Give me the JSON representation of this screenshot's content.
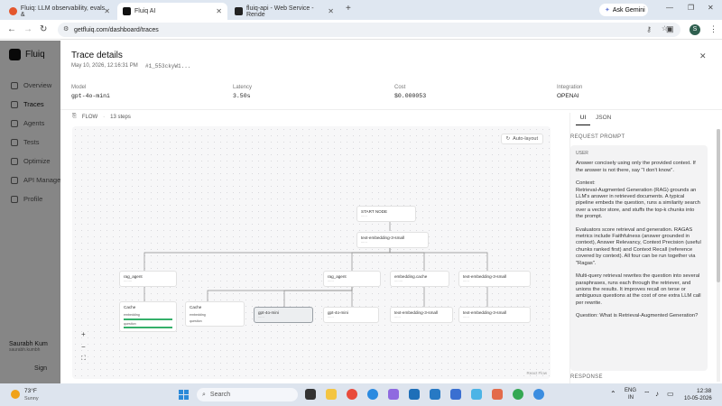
{
  "browser": {
    "tabs": [
      {
        "title": "Fluiq: LLM observability, evals &",
        "favicon_color": "#e4572e"
      },
      {
        "title": "Fluiq AI",
        "favicon_color": "#111111"
      },
      {
        "title": "fluiq-api - Web Service - Rende",
        "favicon_color": "#222222"
      }
    ],
    "new_tab": "+",
    "gemini_label": "Ask Gemini",
    "url": "getfluiq.com/dashboard/traces",
    "profile_initial": "S"
  },
  "sidebar": {
    "logo": "Fluiq",
    "items": [
      {
        "label": "Overview"
      },
      {
        "label": "Traces"
      },
      {
        "label": "Agents"
      },
      {
        "label": "Tests"
      },
      {
        "label": "Optimize"
      },
      {
        "label": "API Manager"
      },
      {
        "label": "Profile"
      }
    ],
    "user_name": "Saurabh Kum",
    "user_email": "saurabh.kumbh",
    "signout": "Sign"
  },
  "trace": {
    "title": "Trace details",
    "timestamp": "May 10, 2026, 12:16:31 PM",
    "trace_id": "#1_553ckyW1...",
    "meta": [
      {
        "label": "Model",
        "value": "gpt-4o-mini"
      },
      {
        "label": "Latency",
        "value": "3.50s"
      },
      {
        "label": "Cost",
        "value": "$0.000053"
      },
      {
        "label": "Integration",
        "value": "OPENAI"
      }
    ],
    "flow_label": "FLOW",
    "steps_label": "13 steps",
    "auto_layout": "Auto-layout",
    "react_flow": "React Flow",
    "zoom_in": "+",
    "zoom_out": "−",
    "fit": "⛶"
  },
  "flow_nodes": [
    {
      "id": "start",
      "label": "START NODE"
    },
    {
      "id": "emb1",
      "label": "text-embedding-3-small"
    },
    {
      "id": "rag1",
      "label": "rag_agent"
    },
    {
      "id": "rag2",
      "label": "rag_agent"
    },
    {
      "id": "embcache",
      "label": "embedding.cache"
    },
    {
      "id": "emb2",
      "label": "text-embedding-3-small"
    },
    {
      "id": "cache1",
      "label": "Cache",
      "rows": [
        "embedding",
        "question"
      ]
    },
    {
      "id": "cache2",
      "label": "Cache",
      "rows": [
        "embedding",
        "question"
      ]
    },
    {
      "id": "gpt1",
      "label": "gpt-4o-mini"
    },
    {
      "id": "gpt2",
      "label": "gpt-4o-mini"
    },
    {
      "id": "emb3",
      "label": "text-embedding-3-small"
    },
    {
      "id": "emb4",
      "label": "text-embedding-3-small"
    }
  ],
  "right_panel": {
    "tabs": [
      "UI",
      "JSON"
    ],
    "request_prompt_label": "REQUEST PROMPT",
    "user_label": "USER",
    "prompt_paragraphs": [
      "Answer concisely using only the provided context. If the answer is not there, say \"I don't know\".",
      "Context:\nRetrieval-Augmented Generation (RAG) grounds an LLM's answer in retrieved documents. A typical pipeline embeds the question, runs a similarity search over a vector store, and stuffs the top-k chunks into the prompt.",
      "Evaluators score retrieval and generation. RAGAS metrics include Faithfulness (answer grounded in context), Answer Relevancy, Context Precision (useful chunks ranked first) and Context Recall (reference covered by context). All four can be run together via \"Ragas\".",
      "Multi-query retrieval rewrites the question into several paraphrases, runs each through the retriever, and unions the results. It improves recall on terse or ambiguous questions at the cost of one extra LLM call per rewrite.",
      "Question: What is Retrieval-Augmented Generation?"
    ],
    "response_label": "RESPONSE"
  },
  "taskbar": {
    "temperature": "73°F",
    "weather": "Sunny",
    "search_placeholder": "Search",
    "lang": "ENG",
    "region": "IN",
    "time": "12:38",
    "date": "10-05-2026"
  }
}
